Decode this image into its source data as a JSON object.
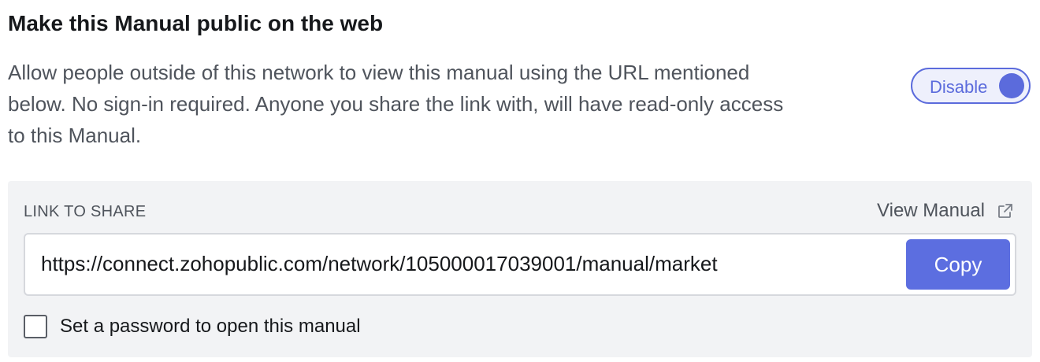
{
  "section": {
    "title": "Make this Manual public on the web",
    "description": "Allow people outside of this network to view this manual using the URL mentioned below. No sign-in required. Anyone you share the link with, will have read-only access to this Manual."
  },
  "toggle": {
    "label": "Disable",
    "state": "on"
  },
  "share": {
    "label": "LINK TO SHARE",
    "view_manual_label": "View Manual",
    "view_manual_icon": "external-link-icon",
    "url": "https://connect.zohopublic.com/network/105000017039001/manual/market",
    "copy_label": "Copy"
  },
  "password": {
    "label": "Set a password to open this manual",
    "checked": false
  },
  "colors": {
    "accent": "#5c6ee0",
    "panel_background": "#f2f3f5",
    "text_muted": "#4f545c"
  }
}
